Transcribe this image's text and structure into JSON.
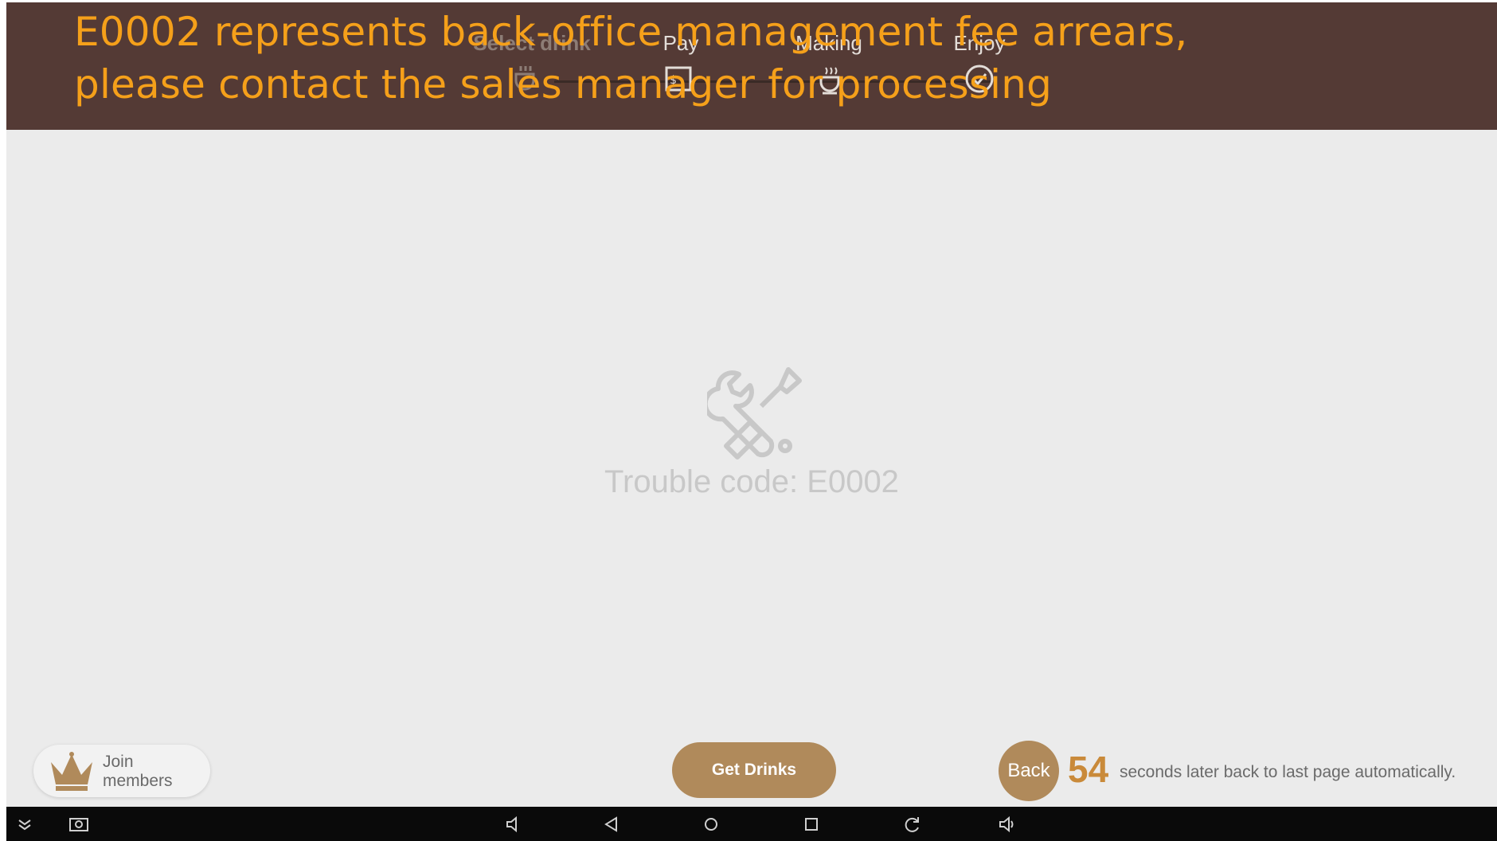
{
  "notice": {
    "line1": "E0002 represents back-office management fee arrears,",
    "line2": "please contact the sales manager for processing"
  },
  "steps": [
    {
      "label": "Select drink",
      "icon": "cup-icon"
    },
    {
      "label": "Pay",
      "icon": "payment-icon"
    },
    {
      "label": "Making",
      "icon": "steaming-cup-icon"
    },
    {
      "label": "Enjoy",
      "icon": "check-circle-icon"
    }
  ],
  "trouble": {
    "icon": "tools-icon",
    "text": "Trouble code: E0002"
  },
  "footer": {
    "join_label": "Join members",
    "get_drinks_label": "Get Drinks",
    "back_label": "Back",
    "countdown": "54",
    "countdown_text": "seconds later back to last page automatically."
  },
  "system_bar": {
    "icons": [
      "collapse-icon",
      "screenshot-icon",
      "volume-down-icon",
      "back-triangle-icon",
      "home-circle-icon",
      "recents-square-icon",
      "rotate-icon",
      "volume-up-icon"
    ]
  },
  "colors": {
    "header_bg": "#543a35",
    "notice_text": "#f5a01a",
    "accent_button": "#b08a5b",
    "countdown": "#c98a3a"
  }
}
